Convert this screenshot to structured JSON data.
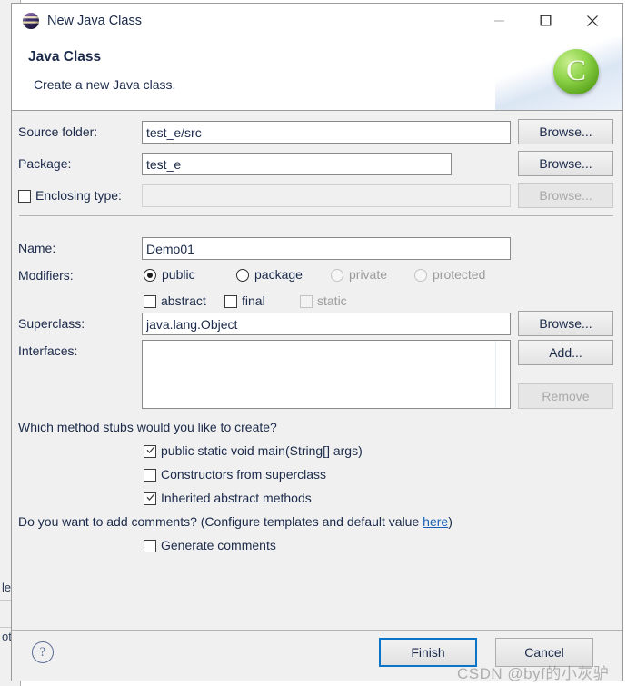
{
  "window": {
    "title": "New Java Class",
    "icon": "eclipse-icon",
    "controls": {
      "minimize": "minimize-icon",
      "maximize": "maximize-icon",
      "close": "close-icon"
    }
  },
  "header": {
    "title": "Java Class",
    "description": "Create a new Java class.",
    "logo_letter": "C",
    "logo_icon": "java-class-badge-icon"
  },
  "form": {
    "source_folder": {
      "label": "Source folder:",
      "value": "test_e/src",
      "browse_label": "Browse..."
    },
    "package": {
      "label": "Package:",
      "value": "test_e",
      "browse_label": "Browse..."
    },
    "enclosing_type": {
      "label": "Enclosing type:",
      "value": "",
      "checked": false,
      "enabled": false,
      "browse_label": "Browse..."
    },
    "name": {
      "label": "Name:",
      "value": "Demo01"
    },
    "modifiers": {
      "label": "Modifiers:",
      "access": [
        {
          "label": "public",
          "selected": true,
          "enabled": true
        },
        {
          "label": "package",
          "selected": false,
          "enabled": true
        },
        {
          "label": "private",
          "selected": false,
          "enabled": false
        },
        {
          "label": "protected",
          "selected": false,
          "enabled": false
        }
      ],
      "flags": [
        {
          "label": "abstract",
          "checked": false,
          "enabled": true
        },
        {
          "label": "final",
          "checked": false,
          "enabled": true
        },
        {
          "label": "static",
          "checked": false,
          "enabled": false
        }
      ]
    },
    "superclass": {
      "label": "Superclass:",
      "value": "java.lang.Object",
      "browse_label": "Browse..."
    },
    "interfaces": {
      "label": "Interfaces:",
      "items": [],
      "add_label": "Add...",
      "remove_label": "Remove"
    }
  },
  "stubs": {
    "question": "Which method stubs would you like to create?",
    "options": [
      {
        "label": "public static void main(String[] args)",
        "checked": true
      },
      {
        "label": "Constructors from superclass",
        "checked": false
      },
      {
        "label": "Inherited abstract methods",
        "checked": true
      }
    ]
  },
  "comments": {
    "question_prefix": "Do you want to add comments? (Configure templates and default value ",
    "link_label": "here",
    "question_suffix": ")",
    "option": {
      "label": "Generate comments",
      "checked": false
    }
  },
  "footer": {
    "help_icon": "help-icon",
    "finish_label": "Finish",
    "cancel_label": "Cancel"
  },
  "backdrop": {
    "fragment_top": "le",
    "fragment_bottom": "ot"
  },
  "watermark": {
    "text": "CSDN @byf的小灰驴"
  },
  "colors": {
    "dialog_background": "#f0f0f0",
    "header_background": "#ffffff",
    "text": "#1b2a4a",
    "disabled_text": "#9b9b9b",
    "link": "#1a5fb4",
    "focus_border": "#0a74c8",
    "logo_green": "#8fd44a"
  }
}
